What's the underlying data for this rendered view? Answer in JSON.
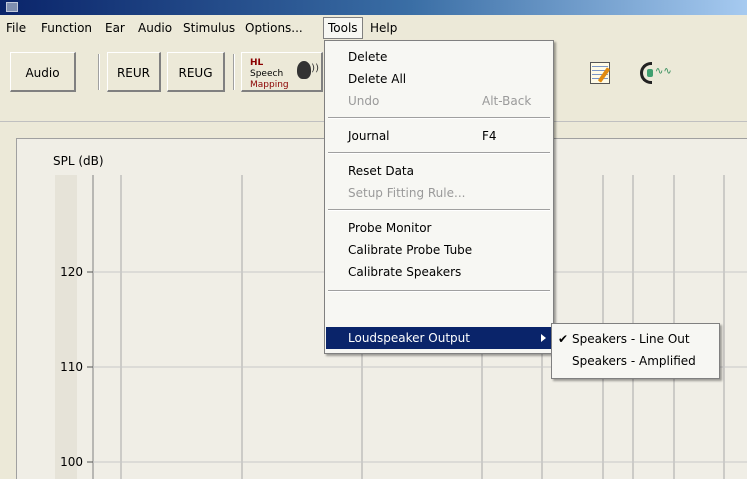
{
  "menubar": {
    "items": [
      "File",
      "Function",
      "Ear",
      "Audio",
      "Stimulus",
      "Options...",
      "Tools",
      "Help"
    ],
    "active": "Tools"
  },
  "toolbar": {
    "audio_label": "Audio",
    "reur_label": "REUR",
    "reug_label": "REUG",
    "speech_mapping": {
      "line1": "HL",
      "line2": "Speech",
      "line3": "Mapping"
    },
    "icons": [
      "speech-mapping-icon",
      "notepad-icon",
      "probe-microphone-icon"
    ]
  },
  "tools_menu": {
    "delete": "Delete",
    "delete_all": "Delete All",
    "undo": "Undo",
    "undo_shortcut": "Alt-Back",
    "journal": "Journal",
    "journal_shortcut": "F4",
    "reset_data": "Reset Data",
    "setup_fitting_rule": "Setup Fitting Rule...",
    "probe_monitor": "Probe Monitor",
    "calibrate_probe_tube": "Calibrate Probe Tube",
    "calibrate_speakers": "Calibrate Speakers",
    "loudspeaker_output": "Loudspeaker Output"
  },
  "submenu": {
    "line_out": "Speakers - Line Out",
    "amplified": "Speakers - Amplified",
    "checked": "Speakers - Line Out"
  },
  "chart_data": {
    "type": "line",
    "ylabel": "SPL (dB)",
    "yticks": [
      120,
      110,
      100
    ],
    "series": []
  },
  "colors": {
    "menu_highlight": "#0a246a",
    "window_bg": "#ece9d8",
    "titlebar_start": "#0a246a"
  }
}
